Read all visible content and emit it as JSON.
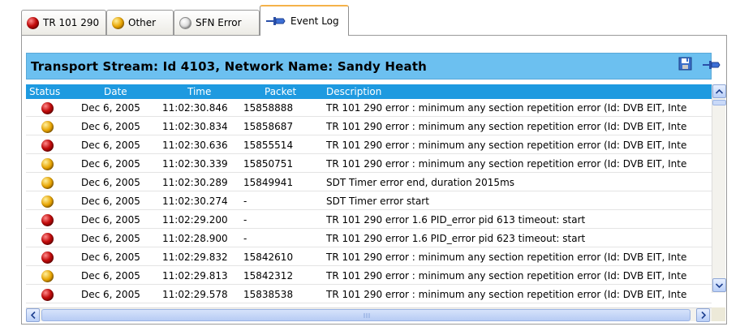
{
  "tabs": [
    {
      "label": "TR 101 290",
      "icon": "red-status-icon",
      "status": "error"
    },
    {
      "label": "Other",
      "icon": "amber-status-icon",
      "status": "warning"
    },
    {
      "label": "SFN Error",
      "icon": "white-status-icon",
      "status": "none"
    },
    {
      "label": "Event Log",
      "icon": "pin-icon",
      "status": "active"
    }
  ],
  "panel": {
    "title": "Transport Stream: Id 4103, Network Name: Sandy Heath"
  },
  "table": {
    "columns": [
      "Status",
      "Date",
      "Time",
      "Packet",
      "Description"
    ],
    "rows": [
      {
        "status": "red",
        "date": "Dec 6, 2005",
        "time": "11:02:30.846",
        "packet": "15858888",
        "description": "TR 101 290 error : minimum any section repetition error (Id: DVB EIT, Inte"
      },
      {
        "status": "amber",
        "date": "Dec 6, 2005",
        "time": "11:02:30.834",
        "packet": "15858687",
        "description": "TR 101 290 error : minimum any section repetition error (Id: DVB EIT, Inte"
      },
      {
        "status": "red",
        "date": "Dec 6, 2005",
        "time": "11:02:30.636",
        "packet": "15855514",
        "description": "TR 101 290 error : minimum any section repetition error (Id: DVB EIT, Inte"
      },
      {
        "status": "amber",
        "date": "Dec 6, 2005",
        "time": "11:02:30.339",
        "packet": "15850751",
        "description": "TR 101 290 error : minimum any section repetition error (Id: DVB EIT, Inte"
      },
      {
        "status": "amber",
        "date": "Dec 6, 2005",
        "time": "11:02:30.289",
        "packet": "15849941",
        "description": "SDT Timer error end, duration 2015ms"
      },
      {
        "status": "amber",
        "date": "Dec 6, 2005",
        "time": "11:02:30.274",
        "packet": "-",
        "description": "SDT Timer error start"
      },
      {
        "status": "red",
        "date": "Dec 6, 2005",
        "time": "11:02:29.200",
        "packet": "-",
        "description": "TR 101 290 error 1.6 PID_error pid 613 timeout: start"
      },
      {
        "status": "red",
        "date": "Dec 6, 2005",
        "time": "11:02:28.900",
        "packet": "-",
        "description": "TR 101 290 error 1.6 PID_error pid 623 timeout: start"
      },
      {
        "status": "red",
        "date": "Dec 6, 2005",
        "time": "11:02:29.832",
        "packet": "15842610",
        "description": "TR 101 290 error : minimum any section repetition error (Id: DVB EIT, Inte"
      },
      {
        "status": "amber",
        "date": "Dec 6, 2005",
        "time": "11:02:29.813",
        "packet": "15842312",
        "description": "TR 101 290 error : minimum any section repetition error (Id: DVB EIT, Inte"
      },
      {
        "status": "red",
        "date": "Dec 6, 2005",
        "time": "11:02:29.578",
        "packet": "15838538",
        "description": "TR 101 290 error : minimum any section repetition error (Id: DVB EIT, Inte"
      }
    ]
  },
  "colors": {
    "title_bar": "#6cc0f0",
    "header": "#1e9ae0",
    "active_tab_accent": "#f5b24a",
    "status_red": "#c20b0b",
    "status_amber": "#e8a400"
  }
}
